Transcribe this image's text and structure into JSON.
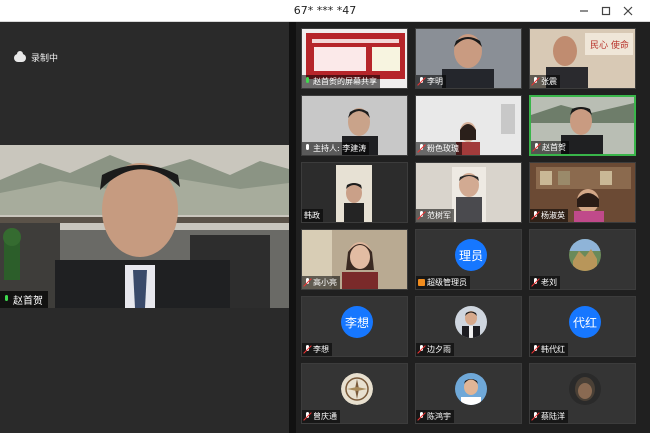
{
  "window": {
    "title": "67* *** *47",
    "minimize_icon": "minimize-icon",
    "maximize_icon": "maximize-icon",
    "close_icon": "close-icon"
  },
  "recording": {
    "label": "录制中",
    "icon": "cloud-icon"
  },
  "main_speaker": {
    "name": "赵首贺",
    "mic": "mic-on-green"
  },
  "participants": [
    {
      "name": "赵首贺的屏幕共享",
      "mic": "green",
      "kind": "screen-share"
    },
    {
      "name": "李明",
      "mic": "muted",
      "kind": "video"
    },
    {
      "name": "张震",
      "mic": "muted",
      "kind": "video"
    },
    {
      "name": "主持人: 李建涛",
      "mic": "on",
      "kind": "video"
    },
    {
      "name": "粉色玫瑰",
      "mic": "muted",
      "kind": "video"
    },
    {
      "name": "赵首贺",
      "mic": "muted",
      "kind": "video",
      "active": true
    },
    {
      "name": "韩政",
      "mic": "none",
      "kind": "video"
    },
    {
      "name": "范树军",
      "mic": "muted",
      "kind": "video"
    },
    {
      "name": "杨淑英",
      "mic": "muted",
      "kind": "video"
    },
    {
      "name": "高小亮",
      "mic": "muted",
      "kind": "video"
    },
    {
      "name": "超级管理员",
      "mic": "flag",
      "kind": "avatar-text",
      "avatar_text": "理员"
    },
    {
      "name": "老刘",
      "mic": "muted",
      "kind": "avatar-photo"
    },
    {
      "name": "李想",
      "mic": "muted",
      "kind": "avatar-text",
      "avatar_text": "李想"
    },
    {
      "name": "边夕雨",
      "mic": "muted",
      "kind": "avatar-photo"
    },
    {
      "name": "韩代红",
      "mic": "muted",
      "kind": "avatar-text",
      "avatar_text": "代红"
    },
    {
      "name": "曾庆通",
      "mic": "muted",
      "kind": "avatar-photo"
    },
    {
      "name": "陈鸿宇",
      "mic": "muted",
      "kind": "avatar-photo"
    },
    {
      "name": "蔡陆洋",
      "mic": "muted",
      "kind": "avatar-photo"
    }
  ],
  "colors": {
    "accent_blue": "#1677ff",
    "active_border": "#39b54a",
    "muted_red": "#e33333",
    "background": "#1c1c1c"
  }
}
